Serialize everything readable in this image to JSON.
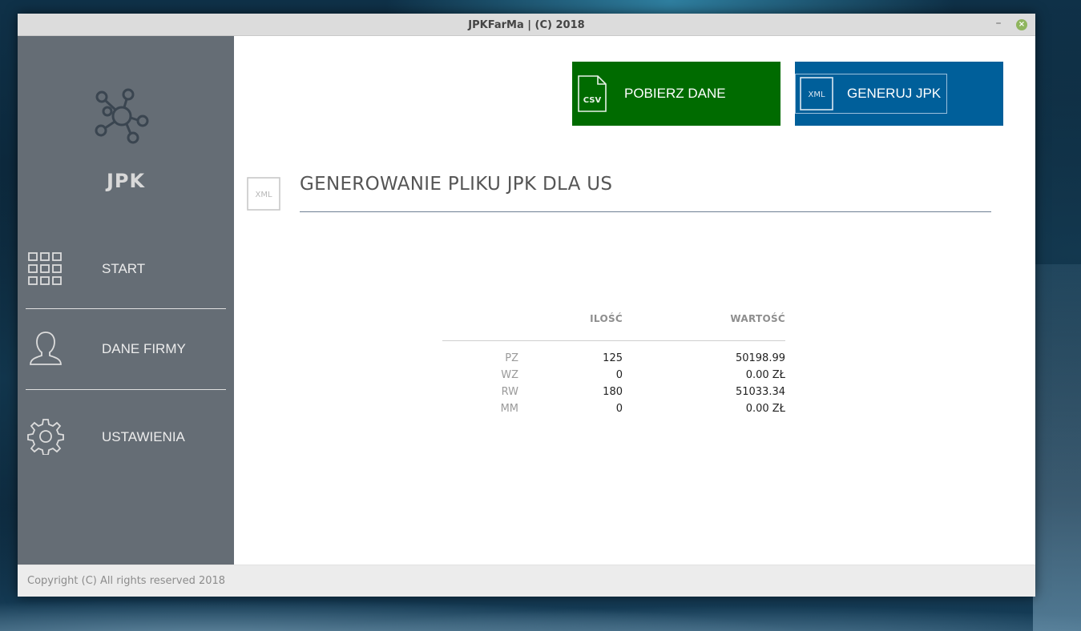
{
  "window": {
    "title": "JPKFarMa | (C) 2018",
    "minimize_glyph": "–",
    "close_glyph": "×"
  },
  "sidebar": {
    "logo_icon": "network-hub-icon",
    "logo_text": "JPK",
    "items": [
      {
        "label": "START",
        "icon": "grid-icon"
      },
      {
        "label": "DANE FIRMY",
        "icon": "user-icon"
      },
      {
        "label": "USTAWIENIA",
        "icon": "gear-icon"
      }
    ]
  },
  "actions": {
    "download": {
      "label": "POBIERZ DANE",
      "icon_text": "CSV",
      "color": "#006b00"
    },
    "generate": {
      "label": "GENERUJ JPK",
      "icon_text": "XML",
      "color": "#005f9a"
    }
  },
  "section": {
    "icon_text": "XML",
    "title": "GENEROWANIE PLIKU JPK DLA US"
  },
  "summary": {
    "headers": {
      "qty": "ILOŚĆ",
      "value": "WARTOŚĆ"
    },
    "rows": [
      {
        "label": "PZ",
        "qty": "125",
        "value": "50198.99"
      },
      {
        "label": "WZ",
        "qty": "0",
        "value": "0.00 ZŁ"
      },
      {
        "label": "RW",
        "qty": "180",
        "value": "51033.34"
      },
      {
        "label": "MM",
        "qty": "0",
        "value": "0.00 ZŁ"
      }
    ]
  },
  "footer": {
    "copyright": "Copyright (C) All rights reserved 2018"
  },
  "colors": {
    "sidebar_bg": "#656d75",
    "accent_green": "#006b00",
    "accent_blue": "#005f9a",
    "titlebar_bg": "#dcdcdc"
  }
}
